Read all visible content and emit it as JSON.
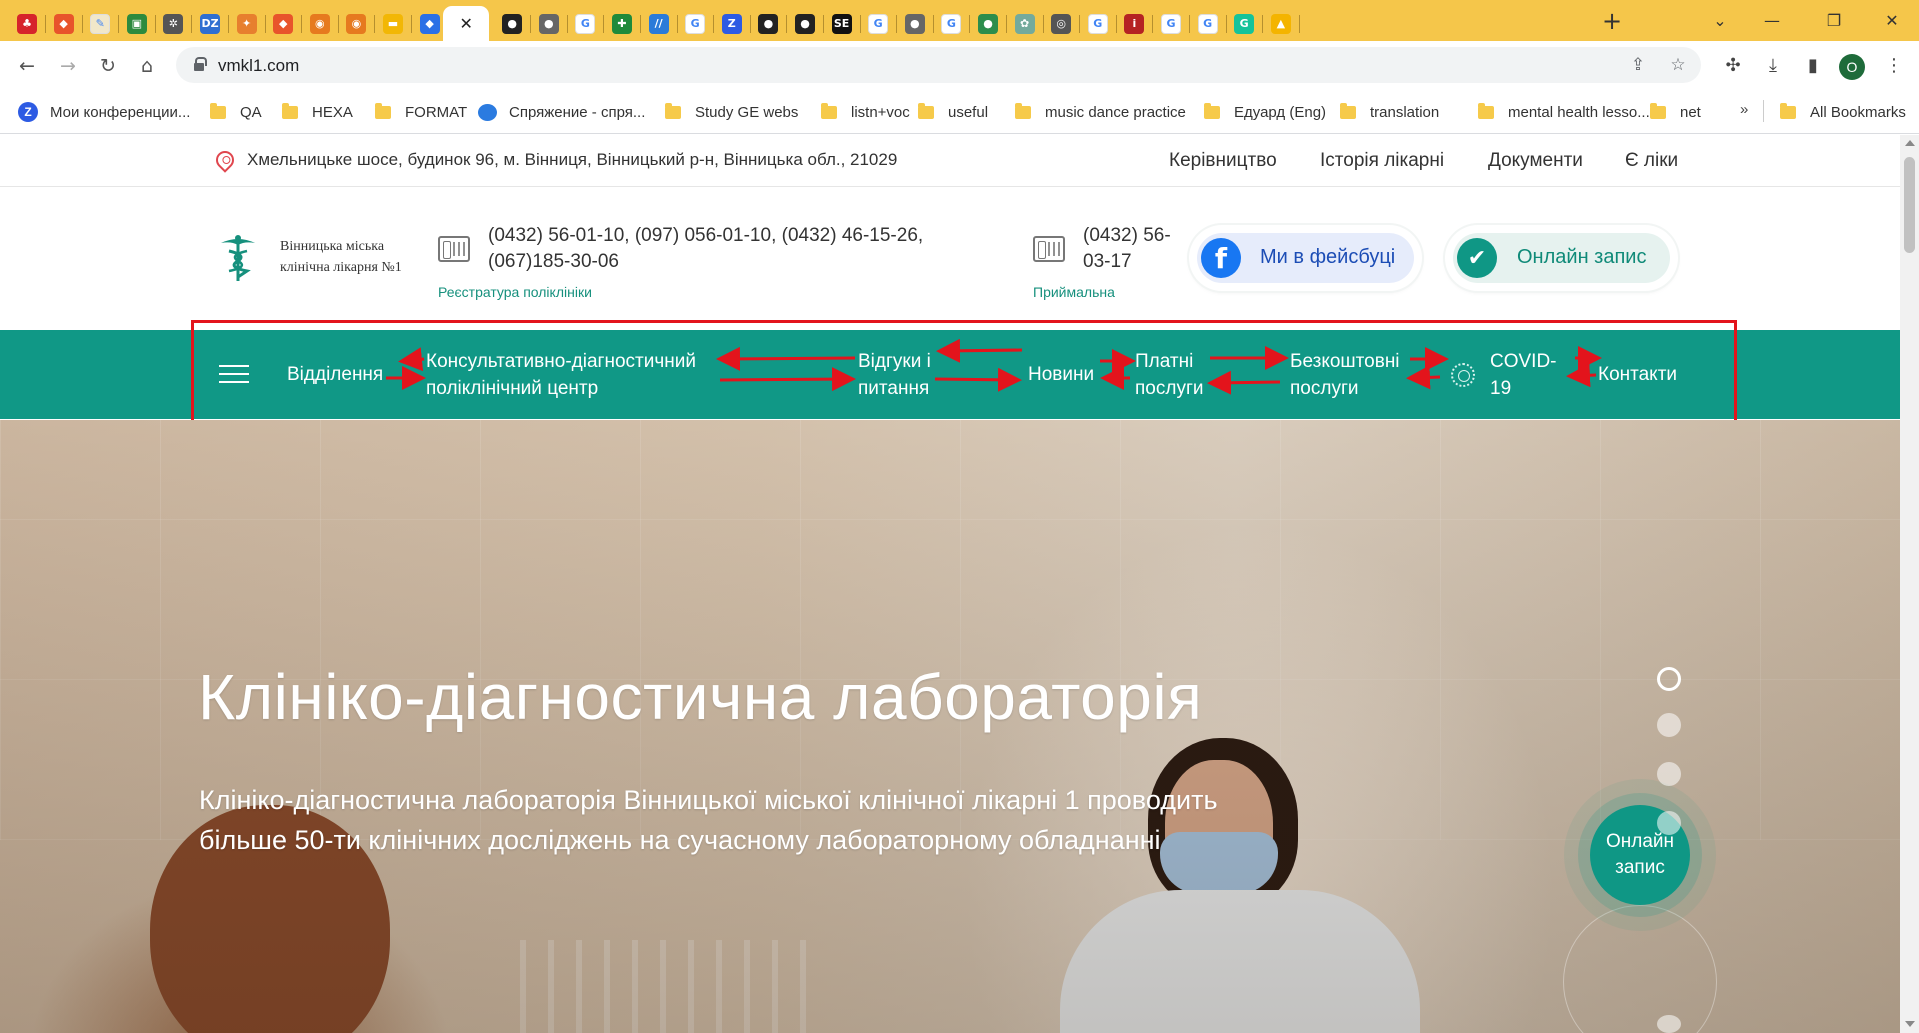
{
  "browser": {
    "tabs": [
      {
        "icon": "heart-icon",
        "color": "#d6242b",
        "glyph": "♣"
      },
      {
        "icon": "diamond-icon",
        "color": "#e8542b",
        "glyph": "◆"
      },
      {
        "icon": "notes-icon",
        "color": "#f1e7c9",
        "glyph": "✎"
      },
      {
        "icon": "sheet-icon",
        "color": "#2d8a3e",
        "glyph": "▣"
      },
      {
        "icon": "gear-icon",
        "color": "#555",
        "glyph": "✲"
      },
      {
        "icon": "dz-icon",
        "color": "#2f6fd1",
        "glyph": "DZ"
      },
      {
        "icon": "pinwheel-icon",
        "color": "#e77f2e",
        "glyph": "✦"
      },
      {
        "icon": "diamond-icon",
        "color": "#e8542b",
        "glyph": "◆"
      },
      {
        "icon": "circle-icon",
        "color": "#e67a1f",
        "glyph": "◉"
      },
      {
        "icon": "circle-icon",
        "color": "#e67a1f",
        "glyph": "◉"
      },
      {
        "icon": "slides-icon",
        "color": "#f2b705",
        "glyph": "▬"
      },
      {
        "icon": "diamond-icon",
        "color": "#2b70e6",
        "glyph": "◆"
      },
      {
        "icon": "close-icon",
        "color": "transparent",
        "glyph": "✕",
        "active": true
      },
      {
        "icon": "dark-circle-icon",
        "color": "#222",
        "glyph": "●"
      },
      {
        "icon": "globe-icon",
        "color": "#666",
        "glyph": "●"
      },
      {
        "icon": "google-icon",
        "color": "#fff",
        "glyph": "G"
      },
      {
        "icon": "plus-green-icon",
        "color": "#1f8a3b",
        "glyph": "✚"
      },
      {
        "icon": "slash-icon",
        "color": "#2a7bd9",
        "glyph": "//"
      },
      {
        "icon": "google-icon",
        "color": "#fff",
        "glyph": "G"
      },
      {
        "icon": "z-icon",
        "color": "#2d5be3",
        "glyph": "Z"
      },
      {
        "icon": "github-icon",
        "color": "#222",
        "glyph": "●"
      },
      {
        "icon": "github-icon",
        "color": "#222",
        "glyph": "●"
      },
      {
        "icon": "se-icon",
        "color": "#111",
        "glyph": "SE"
      },
      {
        "icon": "google-icon",
        "color": "#fff",
        "glyph": "G"
      },
      {
        "icon": "globe-icon",
        "color": "#666",
        "glyph": "●"
      },
      {
        "icon": "google-icon",
        "color": "#fff",
        "glyph": "G"
      },
      {
        "icon": "green-circle-icon",
        "color": "#2c8d4c",
        "glyph": "●"
      },
      {
        "icon": "openai-icon",
        "color": "#74aa9c",
        "glyph": "✿"
      },
      {
        "icon": "chrome-icon",
        "color": "#555",
        "glyph": "◎"
      },
      {
        "icon": "google-icon",
        "color": "#fff",
        "glyph": "G"
      },
      {
        "icon": "info-red-icon",
        "color": "#b52323",
        "glyph": "i"
      },
      {
        "icon": "google-icon",
        "color": "#fff",
        "glyph": "G"
      },
      {
        "icon": "google-icon",
        "color": "#fff",
        "glyph": "G"
      },
      {
        "icon": "grammarly-icon",
        "color": "#15c39a",
        "glyph": "G"
      },
      {
        "icon": "drive-icon",
        "color": "#f4b400",
        "glyph": "▲"
      }
    ],
    "url": "vmkl1.com",
    "profile_letter": "O",
    "bookmarks": [
      {
        "label": "Мои конференции...",
        "kind": "z"
      },
      {
        "label": "QA",
        "kind": "folder"
      },
      {
        "label": "HEXA",
        "kind": "folder"
      },
      {
        "label": "FORMAT",
        "kind": "folder"
      },
      {
        "label": "Спряжение - спря...",
        "kind": "bubble"
      },
      {
        "label": "Study GE webs",
        "kind": "folder"
      },
      {
        "label": "listn+voc",
        "kind": "folder"
      },
      {
        "label": "useful",
        "kind": "folder"
      },
      {
        "label": "music dance practice",
        "kind": "folder"
      },
      {
        "label": "Едуард (Eng)",
        "kind": "folder"
      },
      {
        "label": "translation",
        "kind": "folder"
      },
      {
        "label": "mental health lesso...",
        "kind": "folder"
      },
      {
        "label": "net",
        "kind": "folder"
      }
    ],
    "bookmarks_more": "»",
    "all_bookmarks": "All Bookmarks"
  },
  "site": {
    "address": "Хмельницьке шосе, будинок 96, м. Вінниця, Вінницький р-н, Вінницька обл., 21029",
    "top_links": [
      "Керівництво",
      "Історія лікарні",
      "Документи",
      "Є ліки"
    ],
    "logo_text": [
      "Вінницька міська",
      "клінічна лікарня №1"
    ],
    "registry": {
      "phones": [
        "(0432) 56-01-10, (097) 056-01-10, (0432) 46-15-26,",
        "(067)185-30-06"
      ],
      "caption": "Реєстратура поліклініки"
    },
    "reception": {
      "phones": [
        "(0432) 56-",
        "03-17"
      ],
      "caption": "Приймальна"
    },
    "facebook_button": {
      "label": "Ми в фейсбуці",
      "icon": "facebook-icon"
    },
    "online_button": {
      "label": "Онлайн запис",
      "icon": "check-icon"
    },
    "nav": [
      {
        "lines": [
          "Відділення"
        ]
      },
      {
        "lines": [
          "Консультативно-діагностичний",
          "поліклінічний центр"
        ]
      },
      {
        "lines": [
          "Відгуки і",
          "питання"
        ]
      },
      {
        "lines": [
          "Новини"
        ]
      },
      {
        "lines": [
          "Платні",
          "послуги"
        ]
      },
      {
        "lines": [
          "Безкоштовні",
          "послуги"
        ]
      },
      {
        "lines": [
          "COVID-",
          "19"
        ]
      },
      {
        "lines": [
          "Контакти"
        ]
      }
    ],
    "hero": {
      "title": "Клініко-діагностична лабораторія",
      "subtitle": [
        "Клініко-діагностична лабораторія Вінницької міської клінічної лікарні 1 проводить",
        "більше 50-ти клінічних досліджень на сучасному лабораторному обладнанні"
      ]
    },
    "floating_online": [
      "Онлайн",
      "запис"
    ],
    "slides": {
      "count": 4,
      "active": 1
    }
  },
  "colors": {
    "accent": "#109886",
    "annotation": "#e3141c",
    "tabstrip": "#f5c64a"
  }
}
